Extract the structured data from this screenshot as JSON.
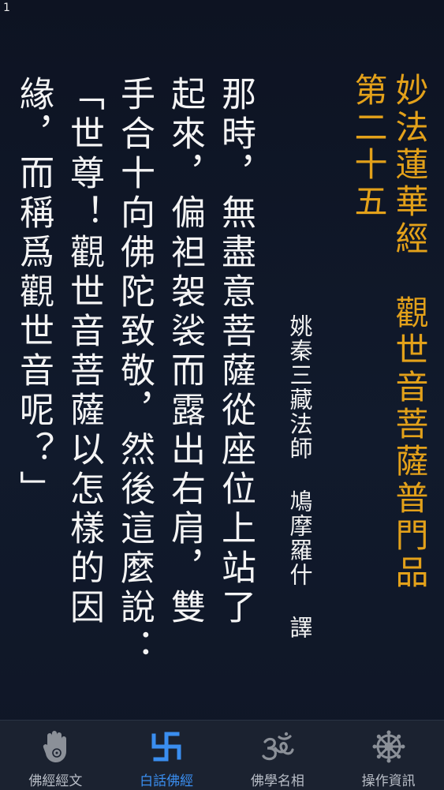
{
  "page_number": "1",
  "title": {
    "line1": "妙法蓮華經　觀世音菩薩普門品",
    "line2": "第二十五"
  },
  "translator": "姚秦三藏法師 鳩摩羅什 譯",
  "body_columns": [
    "那時，無盡意菩薩從座位上站了",
    "起來，偏袒袈裟而露出右肩，雙",
    "手合十向佛陀致敬，然後這麼說：",
    "「世尊！觀世音菩薩以怎樣的因",
    "緣，而稱爲觀世音呢？」"
  ],
  "tabs": [
    {
      "label": "佛經經文",
      "icon": "hand-icon",
      "active": false
    },
    {
      "label": "白話佛經",
      "icon": "swastika-icon",
      "active": true
    },
    {
      "label": "佛學名相",
      "icon": "om-icon",
      "active": false
    },
    {
      "label": "操作資訊",
      "icon": "dharma-wheel-icon",
      "active": false
    }
  ],
  "colors": {
    "background": "#0f1524",
    "title": "#e3a11a",
    "body_text": "#f4f4f4",
    "tab_active": "#3a8ef0",
    "tab_inactive": "#b9bec7"
  }
}
